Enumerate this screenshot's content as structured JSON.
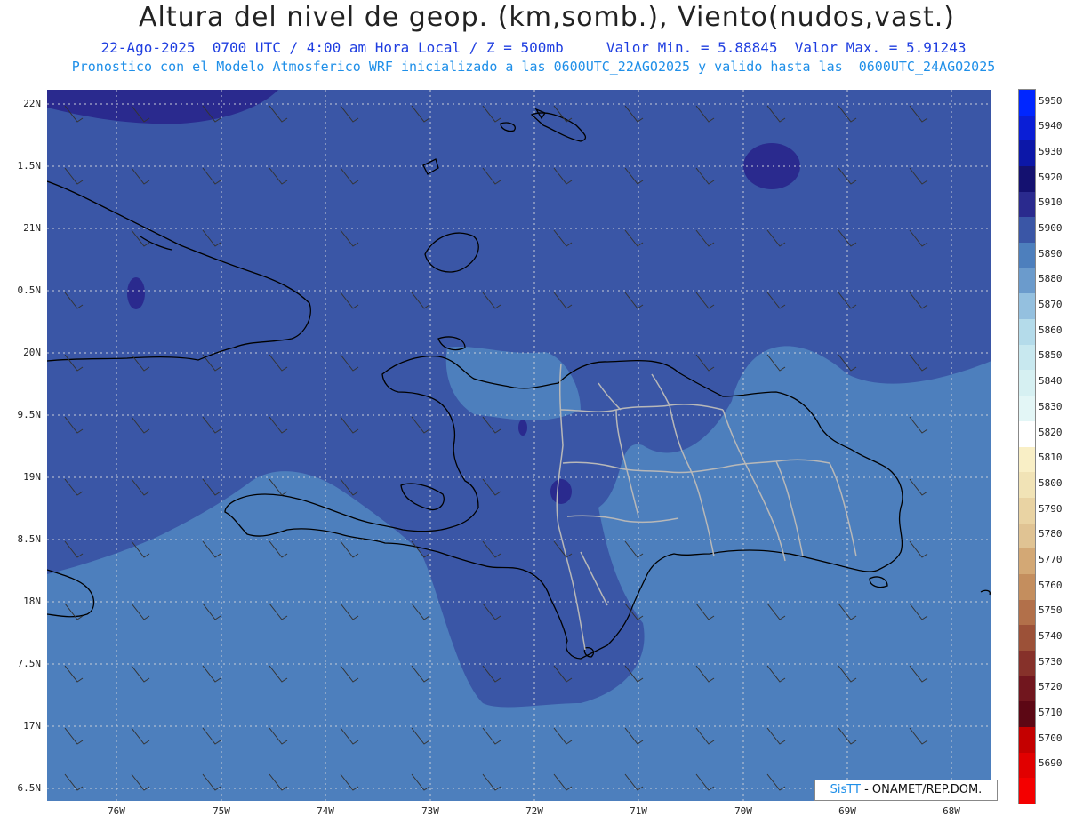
{
  "header": {
    "title": "Altura del nivel de geop. (km,somb.), Viento(nudos,vast.)",
    "subtitle_time": "22-Ago-2025  0700 UTC / 4:00 am Hora Local / Z = 500mb",
    "subtitle_values": "Valor Min. = 5.88845  Valor Max. = 5.91243",
    "subtitle_model": "Pronostico con el Modelo Atmosferico WRF inicializado a las 0600UTC_22AGO2025 y valido hasta las  0600UTC_24AGO2025"
  },
  "axes": {
    "lat_labels": [
      "22N",
      "1.5N",
      "21N",
      "0.5N",
      "20N",
      "9.5N",
      "19N",
      "8.5N",
      "18N",
      "7.5N",
      "17N",
      "6.5N"
    ],
    "lon_labels": [
      "76W",
      "75W",
      "74W",
      "73W",
      "72W",
      "71W",
      "70W",
      "69W",
      "68W"
    ]
  },
  "colorbar": {
    "levels": [
      "5950",
      "5940",
      "5930",
      "5920",
      "5910",
      "5900",
      "5890",
      "5880",
      "5870",
      "5860",
      "5850",
      "5840",
      "5830",
      "5820",
      "5810",
      "5800",
      "5790",
      "5780",
      "5770",
      "5760",
      "5750",
      "5740",
      "5730",
      "5720",
      "5710",
      "5700",
      "5690"
    ],
    "colors": [
      "#0026ff",
      "#0a1ed6",
      "#0c17a8",
      "#141170",
      "#2a2a8e",
      "#3a56a6",
      "#4d7fbd",
      "#6b9bcc",
      "#94c0df",
      "#b4dbea",
      "#c8e8ef",
      "#d6f0f2",
      "#e3f6f6",
      "#ffffff",
      "#f9efc6",
      "#f1e3b6",
      "#e9d3a3",
      "#e0c393",
      "#d3a875",
      "#c48e5e",
      "#b2704a",
      "#9c5138",
      "#86312a",
      "#71161e",
      "#5c0714",
      "#c40000",
      "#e10000",
      "#f40000"
    ],
    "map_colors": {
      "level_5910": "#2a2a8e",
      "level_5900": "#3a56a6",
      "level_5890": "#4d7fbd"
    }
  },
  "credit": {
    "brand": "SisTT",
    "text": "- ONAMET/REP.DOM."
  }
}
